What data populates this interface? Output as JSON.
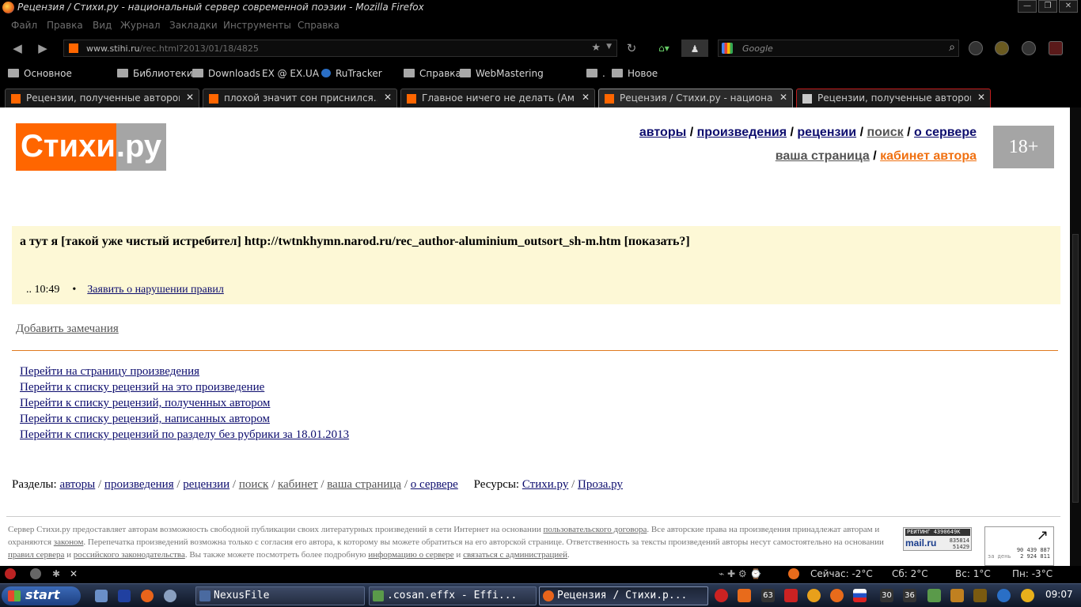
{
  "window": {
    "title": "Рецензия / Стихи.ру - национальный сервер современной поэзии - Mozilla Firefox"
  },
  "menu": [
    "Файл",
    "Правка",
    "Вид",
    "Журнал",
    "Закладки",
    "Инструменты",
    "Справка"
  ],
  "nav": {
    "url_domain": "www.stihi.ru",
    "url_path": "/rec.html?2013/01/18/4825",
    "search_placeholder": "Google"
  },
  "bookmarks": [
    "Основное",
    "Библиотеки",
    "Downloads",
    "EX @ EX.UA",
    "RuTracker",
    "Справка",
    "WebMastering",
    ".",
    "Новое"
  ],
  "tabs": [
    {
      "label": "Рецензии, полученные автором А..."
    },
    {
      "label": "плохой значит сон приснился.. (А..."
    },
    {
      "label": "Главное ничего не делать (Аминь..."
    },
    {
      "label": "Рецензия / Стихи.ру - национальн..."
    },
    {
      "label": "Рецензии, полученные автором Во..."
    }
  ],
  "page": {
    "logo_left": "Стихи",
    "logo_right": ".ру",
    "age_badge": "18+",
    "top_nav": {
      "authors": "авторы",
      "works": "произведения",
      "reviews": "рецензии",
      "search": "поиск",
      "about": "о сервере",
      "your_page": "ваша страница",
      "cabinet": "кабинет автора",
      "sep": "/"
    },
    "review": {
      "text": "а тут я [такой уже чистый истребител] http://twtnkhymn.narod.ru/rec_author-aluminium_outsort_sh-m.htm [показать?]",
      "time": ".. 10:49",
      "dot": "•",
      "report": "Заявить о нарушении правил"
    },
    "add_note": "Добавить замечания",
    "links": [
      "Перейти на страницу произведения",
      "Перейти к списку рецензий на это произведение",
      "Перейти к списку рецензий, полученных автором",
      "Перейти к списку рецензий, написанных автором",
      "Перейти к списку рецензий по разделу без рубрики за 18.01.2013"
    ],
    "sections": {
      "label": "Разделы:",
      "authors": "авторы",
      "works": "произведения",
      "reviews": "рецензии",
      "search": "поиск",
      "cabinet": "кабинет",
      "your_page": "ваша страница",
      "about": "о сервере",
      "resources_label": "Ресурсы:",
      "stihi": "Стихи.ру",
      "proza": "Проза.ру",
      "sep": "/"
    },
    "footer": {
      "p1": "Сервер Стихи.ру предоставляет авторам возможность свободной публикации своих литературных произведений в сети Интернет на основании ",
      "l1": "пользовательского договора",
      "p2": ". Все авторские права на произведения принадлежат авторам и охраняются ",
      "l2": "законом",
      "p3": ". Перепечатка произведений возможна только с согласия его автора, к которому вы можете обратиться на его авторской странице. Ответственность за тексты произведений авторы несут самостоятельно на основании ",
      "l3": "правил сервера",
      "p4": " и ",
      "l4": "российского законодательства",
      "p5": ". Вы также можете посмотреть более подробную ",
      "l5": "информацию о сервере",
      "p6": " и ",
      "l6": "связаться с администрацией",
      "p7": "."
    },
    "counter_mail": {
      "rating": "РЕЙТИНГ 4390649К",
      "brand": "mail.ru",
      "n1": "835814",
      "n2": "51429"
    },
    "counter_li": {
      "n1": "90 439 887",
      "label": "за день",
      "n2": "2 924 811"
    }
  },
  "statusbar": {
    "now": "Сейчас: -2°C",
    "sat": "Сб: 2°C",
    "sun": "Вс: 1°C",
    "mon": "Пн: -3°C"
  },
  "taskbar": {
    "start": "start",
    "tasks": [
      "NexusFile",
      ".cosan.effx - Effi...",
      "Рецензия / Стихи.р..."
    ],
    "tray_numbers": [
      "63",
      "30",
      "36"
    ],
    "clock": "09:07"
  }
}
